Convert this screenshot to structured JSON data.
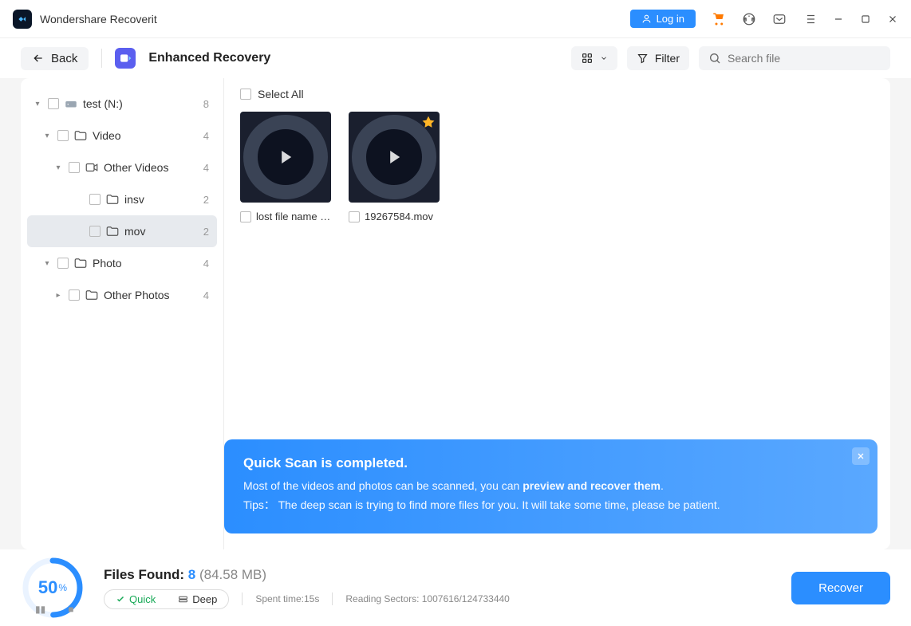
{
  "app": {
    "title": "Wondershare Recoverit"
  },
  "titlebar": {
    "login": "Log in"
  },
  "toolbar": {
    "back": "Back",
    "title": "Enhanced Recovery",
    "filter": "Filter",
    "search_placeholder": "Search file"
  },
  "tree": [
    {
      "label": "test (N:)",
      "count": "8",
      "indent": 0,
      "icon": "drive",
      "chevron": "down",
      "active": false
    },
    {
      "label": "Video",
      "count": "4",
      "indent": 1,
      "icon": "folder",
      "chevron": "down",
      "active": false
    },
    {
      "label": "Other Videos",
      "count": "4",
      "indent": 2,
      "icon": "video",
      "chevron": "down",
      "active": false
    },
    {
      "label": "insv",
      "count": "2",
      "indent": 3,
      "icon": "folder",
      "chevron": "",
      "active": false
    },
    {
      "label": "mov",
      "count": "2",
      "indent": 3,
      "icon": "folder",
      "chevron": "",
      "active": true
    },
    {
      "label": "Photo",
      "count": "4",
      "indent": 1,
      "icon": "folder",
      "chevron": "down",
      "active": false
    },
    {
      "label": "Other Photos",
      "count": "4",
      "indent": 2,
      "icon": "folder",
      "chevron": "right",
      "active": false
    }
  ],
  "content": {
    "select_all": "Select All",
    "thumbs": [
      {
        "name": "lost file name (...",
        "badge": false
      },
      {
        "name": "19267584.mov",
        "badge": true
      }
    ]
  },
  "notif": {
    "title": "Quick Scan is completed.",
    "line1_pre": "Most of the videos and photos can be scanned, you can ",
    "line1_bold": "preview and recover them",
    "line1_post": ".",
    "line2": "Tips： The deep scan is trying to find more files for you. It will take some time, please be patient."
  },
  "footer": {
    "progress_pct": "50",
    "files_found_label": "Files Found: ",
    "files_found_num": "8",
    "files_found_size": " (84.58 MB)",
    "quick": "Quick",
    "deep": "Deep",
    "spent": "Spent time:15s",
    "sectors": "Reading Sectors: 1007616/124733440",
    "recover": "Recover"
  }
}
